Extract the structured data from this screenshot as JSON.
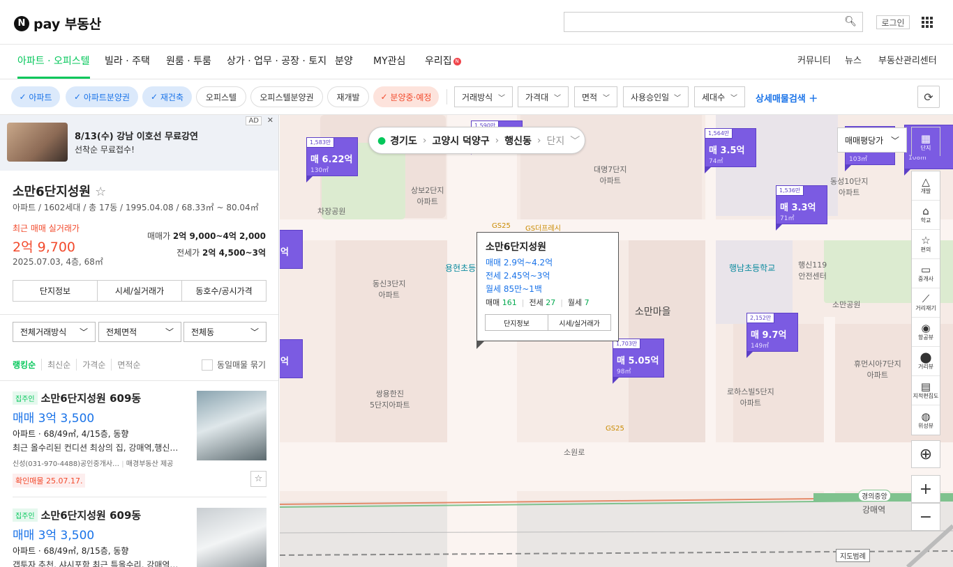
{
  "header": {
    "logo_text": "pay 부동산",
    "search_placeholder": "",
    "login_label": "로그인"
  },
  "nav": {
    "items": [
      "아파트 · 오피스텔",
      "빌라 · 주택",
      "원룸 · 투룸",
      "상가 · 업무 · 공장 · 토지",
      "분양",
      "MY관심",
      "우리집"
    ],
    "right": [
      "커뮤니티",
      "뉴스",
      "부동산관리센터"
    ]
  },
  "filters": {
    "chips": [
      {
        "label": "아파트",
        "checked": true
      },
      {
        "label": "아파트분양권",
        "checked": true
      },
      {
        "label": "재건축",
        "checked": true
      },
      {
        "label": "오피스텔",
        "checked": false
      },
      {
        "label": "오피스텔분양권",
        "checked": false
      },
      {
        "label": "재개발",
        "checked": false
      },
      {
        "label": "분양중·예정",
        "checked": true
      }
    ],
    "dropdowns": [
      "거래방식",
      "가격대",
      "면적",
      "사용승인일",
      "세대수"
    ],
    "detail_search": "상세매물검색"
  },
  "ad": {
    "title": "8/13(수) 강남 이호선 무료강연",
    "subtitle": "선착순 무료접수!",
    "tag": "AD"
  },
  "complex": {
    "name": "소만6단지성원",
    "info": "아파트 / 1602세대 / 총 17동 / 1995.04.08 / 68.33㎡ ~ 80.04㎡",
    "recent_label": "최근 매매 실거래가",
    "recent_price": "2억 9,700",
    "recent_detail": "2025.07.03, 4층, 68㎡",
    "sale_label": "매매가",
    "sale_range": "2억 9,000~4억 2,000",
    "jeonse_label": "전세가",
    "jeonse_range": "2억 4,500~3억",
    "tabs": [
      "단지정보",
      "시세/실거래가",
      "동호수/공시가격"
    ]
  },
  "list_filters": [
    "전체거래방식",
    "전체면적",
    "전체동"
  ],
  "sorts": [
    "랭킹순",
    "최신순",
    "가격순",
    "면적순"
  ],
  "same_listing_label": "동일매물 묶기",
  "listings": [
    {
      "badge": "집주인",
      "title": "소만6단지성원 609동",
      "price": "매매 3억 3,500",
      "info": "아파트 · 68/49㎡, 4/15층, 동향",
      "desc": "최근 올수리된 컨디션 최상의 집, 강매역,행신…",
      "agent": "신성(031-970-4488)공인중개사…",
      "provider": "매경부동산 제공",
      "confirm": "확인매물 25.07.17."
    },
    {
      "badge": "집주인",
      "title": "소만6단지성원 609동",
      "price": "매매 3억 3,500",
      "info": "아파트 · 68/49㎡, 8/15층, 동향",
      "desc": "갭투자 추천, 샤시포함 최근 특올수리, 강매역…"
    }
  ],
  "map": {
    "breadcrumb": [
      "경기도",
      "고양시 덕양구",
      "행신동",
      "단지"
    ],
    "map_type": "매매평당가",
    "tools": [
      "단지",
      "개발",
      "학교",
      "편의",
      "중개사",
      "거리재기",
      "항공뷰",
      "거리뷰",
      "지적편집도",
      "위성뷰"
    ],
    "popup": {
      "name": "소만6단지성원",
      "sale": "매매 2.9억~4.2억",
      "jeonse": "전세 2.45억~3억",
      "rent": "월세 85만~1백",
      "counts": [
        {
          "label": "매매",
          "value": "161"
        },
        {
          "label": "전세",
          "value": "27"
        },
        {
          "label": "월세",
          "value": "7"
        }
      ],
      "buttons": [
        "단지정보",
        "시세/실거래가"
      ]
    },
    "markers": [
      {
        "top": "1,583만",
        "price": "매 6.22억",
        "area": "130㎡"
      },
      {
        "top": "1,590만",
        "price": "",
        "area": ""
      },
      {
        "top": "1,564만",
        "price": "매 3.5억",
        "area": "74㎡"
      },
      {
        "top": "1,536만",
        "price": "매 3.3억",
        "area": "71㎡"
      },
      {
        "top": "2,152만",
        "price": "매 9.7억",
        "area": "149㎡"
      },
      {
        "top": "1,703만",
        "price": "매 5.05억",
        "area": "98㎡"
      },
      {
        "top": "",
        "price": "억",
        "area": ""
      },
      {
        "top": "",
        "price": "억",
        "area": ""
      },
      {
        "top": "",
        "price": "",
        "area": "103㎡"
      },
      {
        "top": "",
        "price": "",
        "area": "108㎡"
      }
    ],
    "labels": {
      "school1": "용현초등학교",
      "school2": "행남초등학교",
      "apt1": "동신3단지\n아파트",
      "apt2": "대명7단지\n아파트",
      "apt3": "상보2단지\n아파트",
      "apt4": "동성10단지\n아파트",
      "apt5": "휴먼시아7단지\n아파트",
      "apt6": "로하스빌5단지\n아파트",
      "apt7": "쌍용한진\n5단지아파트",
      "park1": "차장공원",
      "park2": "소만공원",
      "village": "소만마을",
      "fire": "행신119\n안전센터",
      "gs1": "GS25",
      "gs2": "GS더프레시",
      "gs3": "GS25",
      "road": "소원로",
      "station": "강매역",
      "line_badge": "경의중앙",
      "map_edit": "지도범례"
    }
  }
}
